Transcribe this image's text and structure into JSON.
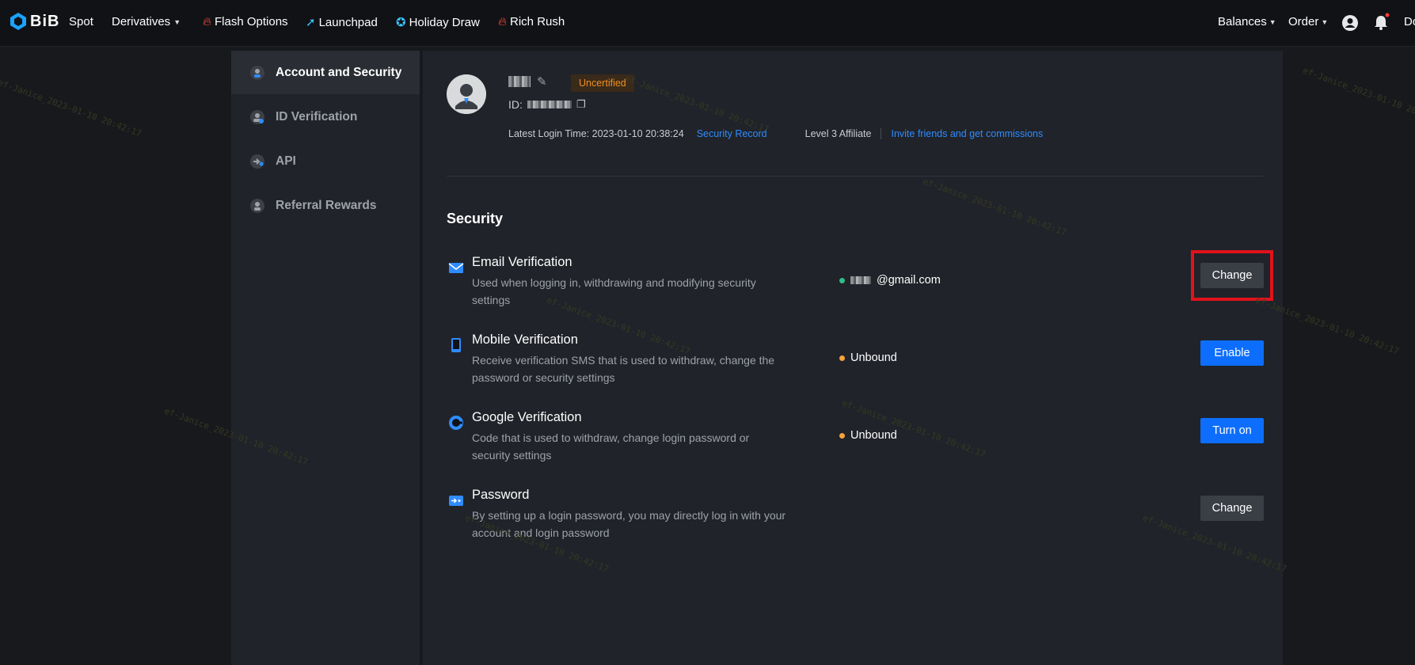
{
  "nav": {
    "logo": "BiB",
    "items": [
      {
        "label": "Spot"
      },
      {
        "label": "Derivatives"
      },
      {
        "label": "Flash Options"
      },
      {
        "label": "Launchpad"
      },
      {
        "label": "Holiday Draw"
      },
      {
        "label": "Rich Rush"
      }
    ],
    "right": {
      "balances": "Balances",
      "order": "Order",
      "download": "Do"
    }
  },
  "sidebar": {
    "items": [
      {
        "label": "Account and Security",
        "icon": "user-shield-icon"
      },
      {
        "label": "ID Verification",
        "icon": "id-user-icon"
      },
      {
        "label": "API",
        "icon": "api-icon"
      },
      {
        "label": "Referral Rewards",
        "icon": "referral-icon"
      }
    ]
  },
  "profile": {
    "badge": "Uncertified",
    "id_label": "ID:",
    "login_time": "Latest Login Time: 2023-01-10 20:38:24",
    "security_record": "Security Record",
    "affiliate": "Level 3 Affiliate",
    "invite": "Invite friends and get commissions"
  },
  "security": {
    "title": "Security",
    "rows": [
      {
        "title": "Email Verification",
        "desc": "Used when logging in, withdrawing and modifying security settings",
        "status": "@gmail.com",
        "status_color": "#2ebd85",
        "button": "Change"
      },
      {
        "title": "Mobile Verification",
        "desc": "Receive verification SMS that is used to withdraw, change the password or security settings",
        "status": "Unbound",
        "status_color": "#f7a23b",
        "button": "Enable"
      },
      {
        "title": "Google Verification",
        "desc": "Code that is used to withdraw, change login password or security settings",
        "status": "Unbound",
        "status_color": "#f7a23b",
        "button": "Turn on"
      },
      {
        "title": "Password",
        "desc": "By setting up a login password, you may directly log in with your account and login password",
        "status": "",
        "button": "Change"
      }
    ]
  },
  "watermark": "ef-Janice_2023-01-10 20:42:17"
}
